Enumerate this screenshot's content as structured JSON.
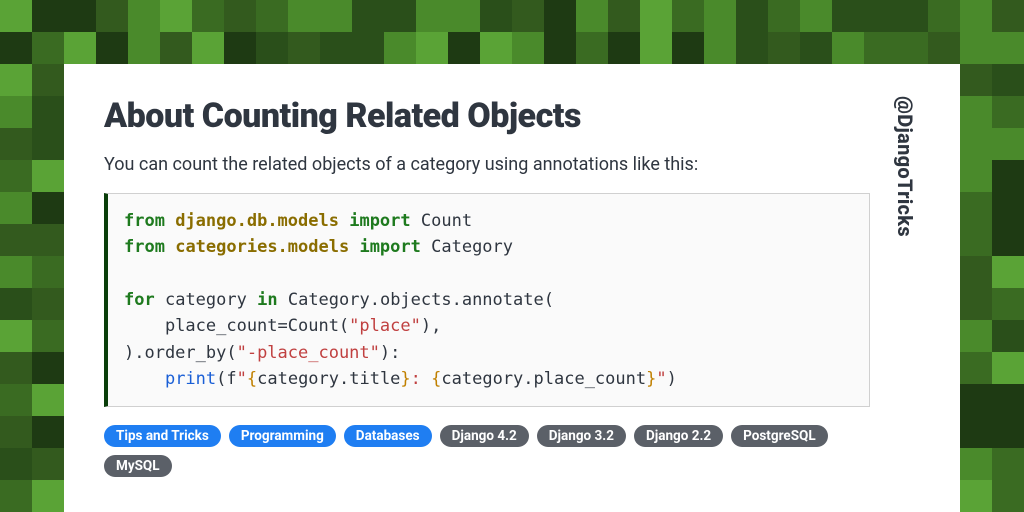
{
  "heading": "About Counting Related Objects",
  "lead": "You can count the related objects of a category using annotations like this:",
  "handle": "@DjangoTricks",
  "code": {
    "l1_kw1": "from",
    "l1_mod": "django.db.models",
    "l1_kw2": "import",
    "l1_name": "Count",
    "l2_kw1": "from",
    "l2_mod": "categories.models",
    "l2_kw2": "import",
    "l2_name": "Category",
    "l3_kw1": "for",
    "l3_var": "category",
    "l3_kw2": "in",
    "l3_expr": "Category.objects.annotate(",
    "l4": "    place_count=Count(",
    "l4_str": "\"place\"",
    "l4_end": "),",
    "l5": ").order_by(",
    "l5_str": "\"-place_count\"",
    "l5_end": "):",
    "l6_indent": "    ",
    "l6_fn": "print",
    "l6_open": "(f",
    "l6_q1": "\"",
    "l6_br1": "{",
    "l6_e1": "category.title",
    "l6_br2": "}",
    "l6_colon": ": ",
    "l6_br3": "{",
    "l6_e2": "category.place_count",
    "l6_br4": "}",
    "l6_q2": "\"",
    "l6_close": ")"
  },
  "tags": [
    {
      "label": "Tips and Tricks",
      "cls": "blue"
    },
    {
      "label": "Programming",
      "cls": "blue"
    },
    {
      "label": "Databases",
      "cls": "blue"
    },
    {
      "label": "Django 4.2",
      "cls": "gray"
    },
    {
      "label": "Django 3.2",
      "cls": "gray"
    },
    {
      "label": "Django 2.2",
      "cls": "gray"
    },
    {
      "label": "PostgreSQL",
      "cls": "gray"
    },
    {
      "label": "MySQL",
      "cls": "gray"
    }
  ],
  "bg_palette": [
    "#1e3a13",
    "#2a4f1a",
    "#3a6b22",
    "#4a8a2b",
    "#5aa336",
    "#335a1e"
  ]
}
